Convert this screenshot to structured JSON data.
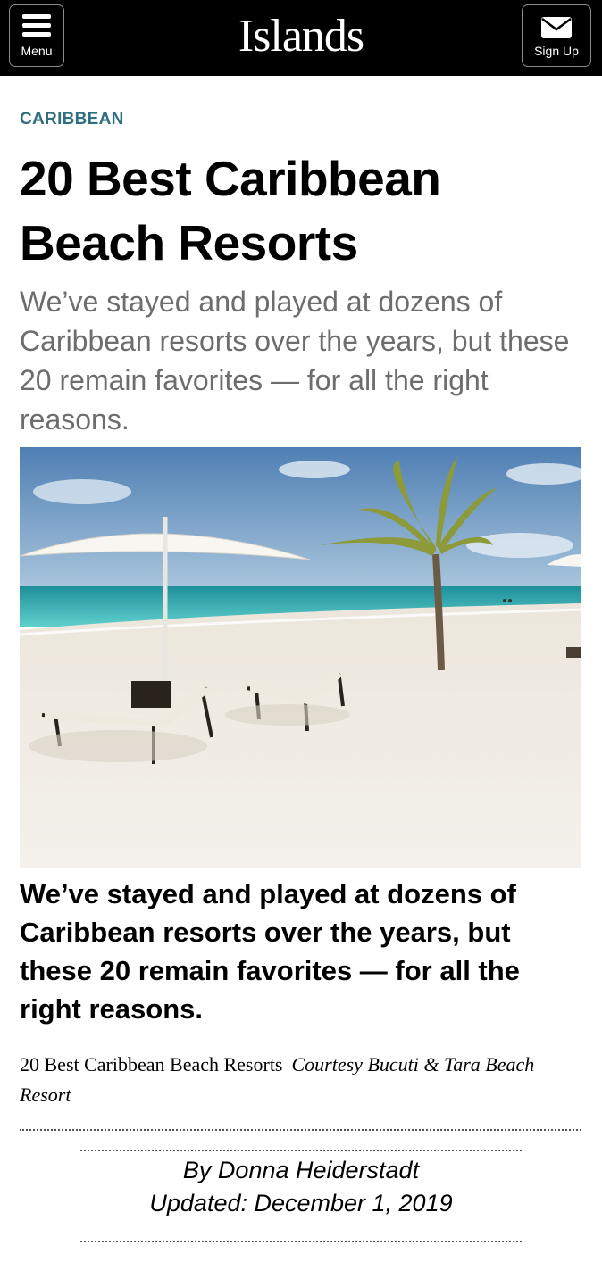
{
  "header": {
    "menu_label": "Menu",
    "logo": "Islands",
    "signup_label": "Sign Up"
  },
  "article": {
    "category": "CARIBBEAN",
    "title": "20 Best Caribbean Beach Resorts",
    "dek": "We’ve stayed and played at dozens of Caribbean resorts over the years, but these 20 remain favorites — for all the right reasons.",
    "image_caption": "We’ve stayed and played at dozens of Caribbean resorts over the years, but these 20 remain favorites — for all the right reasons.",
    "image_title": "20 Best Caribbean Beach Resorts",
    "image_credit": "Courtesy Bucuti & Tara Beach Resort",
    "author": "By Donna Heiderstadt",
    "updated": "Updated: December 1, 2019"
  },
  "icons": {
    "menu": "hamburger-icon",
    "signup": "envelope-icon"
  },
  "colors": {
    "header_bg": "#000000",
    "category": "#2f6f80",
    "dek": "#6d6d6d"
  }
}
